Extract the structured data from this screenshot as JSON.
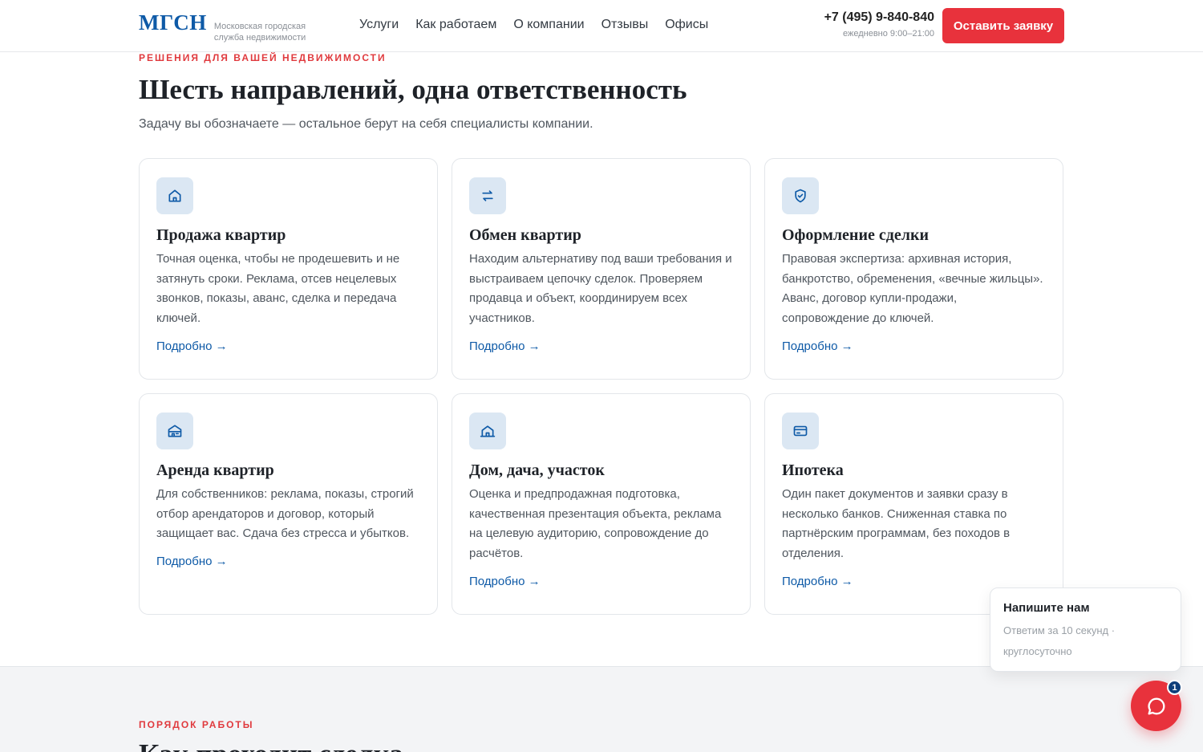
{
  "header": {
    "logo": "МГСН",
    "logo_sub": "Московская городская служба недвижимости",
    "nav": [
      "Услуги",
      "Как работаем",
      "О компании",
      "Отзывы",
      "Офисы"
    ],
    "phone": "+7 (495) 9-840-840",
    "hours": "ежедневно 9:00–21:00",
    "cta": "Оставить заявку"
  },
  "services": {
    "eyebrow": "РЕШЕНИЯ ДЛЯ ВАШЕЙ НЕДВИЖИМОСТИ",
    "title": "Шесть направлений, одна ответственность",
    "lead": "Задачу вы обозначаете — остальное берут на себя специалисты компании.",
    "cards": [
      {
        "icon": "home-icon",
        "title": "Продажа квартир",
        "text": "Точная оценка, чтобы не продешевить и не затянуть сроки. Реклама, отсев нецелевых звонков, показы, аванс, сделка и передача ключей.",
        "link": "Подробно →"
      },
      {
        "icon": "exchange-arrows-icon",
        "title": "Обмен квартир",
        "text": "Находим альтернативу под ваши требования и выстраиваем цепочку сделок. Проверяем продавца и объект, координируем всех участников.",
        "link": "Подробно →"
      },
      {
        "icon": "shield-check-icon",
        "title": "Оформление сделки",
        "text": "Правовая экспертиза: архивная история, банкротство, обременения, «вечные жильцы». Аванс, договор купли-продажи, сопровождение до ключей.",
        "link": "Подробно →"
      },
      {
        "icon": "building-icon",
        "title": "Аренда квартир",
        "text": "Для собственников: реклама, показы, строгий отбор арендаторов и договор, который защищает вас. Сдача без стресса и убытков.",
        "link": "Подробно →"
      },
      {
        "icon": "house-icon",
        "title": "Дом, дача, участок",
        "text": "Оценка и предпродажная подготовка, качественная презентация объекта, реклама на целевую аудиторию, сопровождение до расчётов.",
        "link": "Подробно →"
      },
      {
        "icon": "credit-card-icon",
        "title": "Ипотека",
        "text": "Один пакет документов и заявки сразу в несколько банков. Сниженная ставка по партнёрским программам, без походов в отделения.",
        "link": "Подробно →"
      }
    ]
  },
  "process": {
    "eyebrow": "ПОРЯДОК РАБОТЫ",
    "title": "Как проходит сделка"
  },
  "chat": {
    "title": "Напишите нам",
    "subtitle": "Ответим за 10 секунд · круглосуточно",
    "badge": "1"
  },
  "colors": {
    "brand": "#0e5aa7",
    "accent": "#e8323c",
    "icon_bg": "#dbe7f3"
  }
}
